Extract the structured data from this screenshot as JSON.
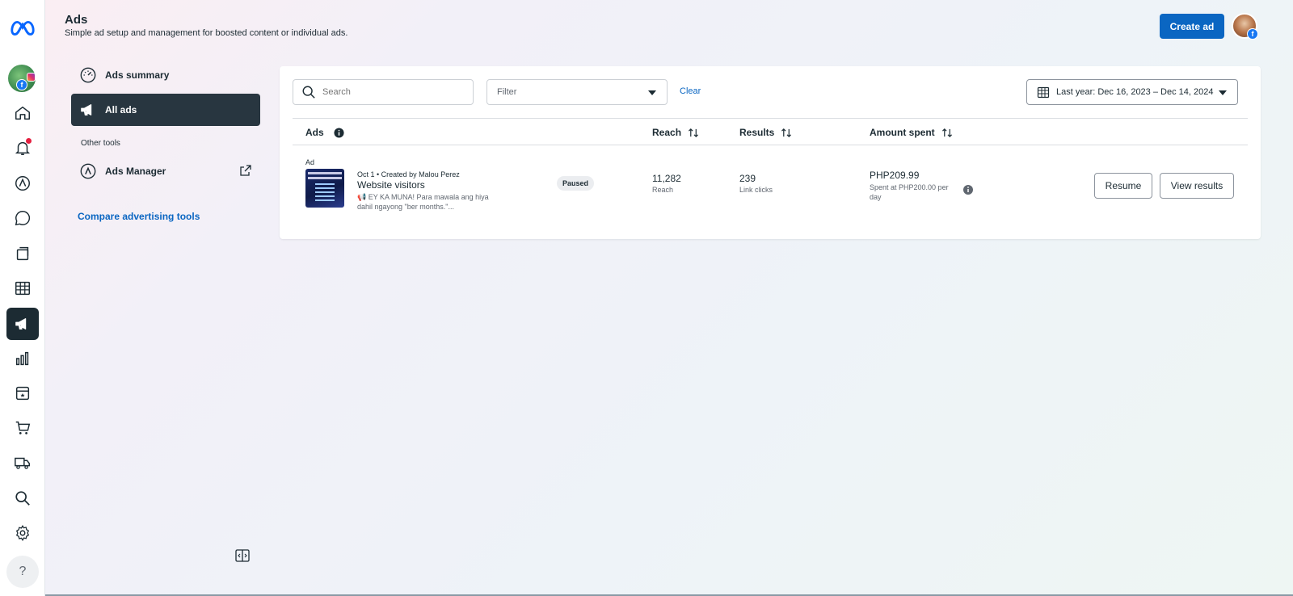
{
  "header": {
    "title": "Ads",
    "subtitle": "Simple ad setup and management for boosted content or individual ads.",
    "create_label": "Create ad"
  },
  "rail": {
    "icons": [
      "meta-logo-icon",
      "home-icon",
      "notifications-icon",
      "ads-center-icon",
      "inbox-icon",
      "content-icon",
      "planner-icon",
      "ads-icon",
      "insights-icon",
      "monetization-icon",
      "commerce-icon",
      "delivery-icon",
      "search-icon",
      "settings-icon",
      "help-icon"
    ]
  },
  "menu": {
    "items": [
      {
        "label": "Ads summary",
        "icon": "dashboard-icon"
      },
      {
        "label": "All ads",
        "icon": "megaphone-icon"
      }
    ],
    "section_label": "Other tools",
    "tools": [
      {
        "label": "Ads Manager",
        "icon": "ads-manager-icon"
      }
    ],
    "compare_label": "Compare advertising tools"
  },
  "toolbar": {
    "search_placeholder": "Search",
    "filter_label": "Filter",
    "clear_label": "Clear",
    "date_range_label": "Last year: Dec 16, 2023 – Dec 14, 2024"
  },
  "table": {
    "columns": [
      "Ads",
      "Reach",
      "Results",
      "Amount spent"
    ],
    "rows": [
      {
        "tag": "Ad",
        "meta": "Oct 1 • Created by Malou Perez",
        "title": "Website visitors",
        "description": "📢 EY KA MUNA! Para mawala ang hiya dahil ngayong \"ber months.\"...",
        "status": "Paused",
        "reach_value": "11,282",
        "reach_label": "Reach",
        "results_value": "239",
        "results_label": "Link clicks",
        "amount_value": "PHP209.99",
        "amount_label": "Spent at PHP200.00 per day",
        "resume_label": "Resume",
        "view_results_label": "View results"
      }
    ]
  },
  "colors": {
    "accent": "#0a66c2",
    "active_nav": "#283640",
    "text": "#1c2b33"
  }
}
